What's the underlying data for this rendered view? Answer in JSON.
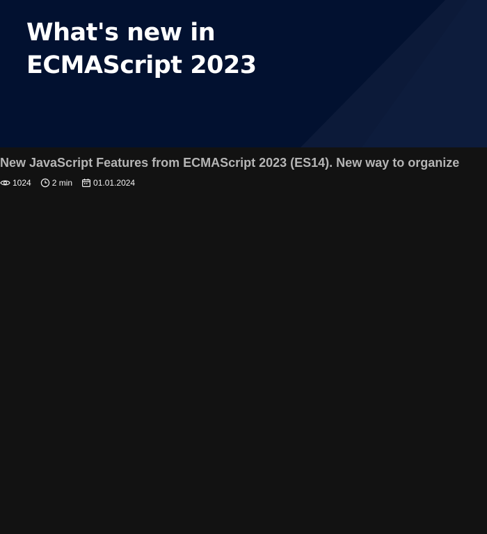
{
  "hero": {
    "title": "What's new in ECMAScript 2023",
    "background_color": "#021130",
    "stripe_color": "#0f1d3d"
  },
  "article": {
    "title": "New JavaScript Features from ECMAScript 2023 (ES14). New way to organize"
  },
  "meta": {
    "views": "1024",
    "views_icon": "eye-icon",
    "read_time": "2 min",
    "read_time_icon": "clock-icon",
    "date": "01.01.2024",
    "date_icon": "calendar-icon"
  },
  "colors": {
    "page_background": "#121212",
    "title_text": "#b5b5b5",
    "meta_text": "#f2f2f2"
  }
}
